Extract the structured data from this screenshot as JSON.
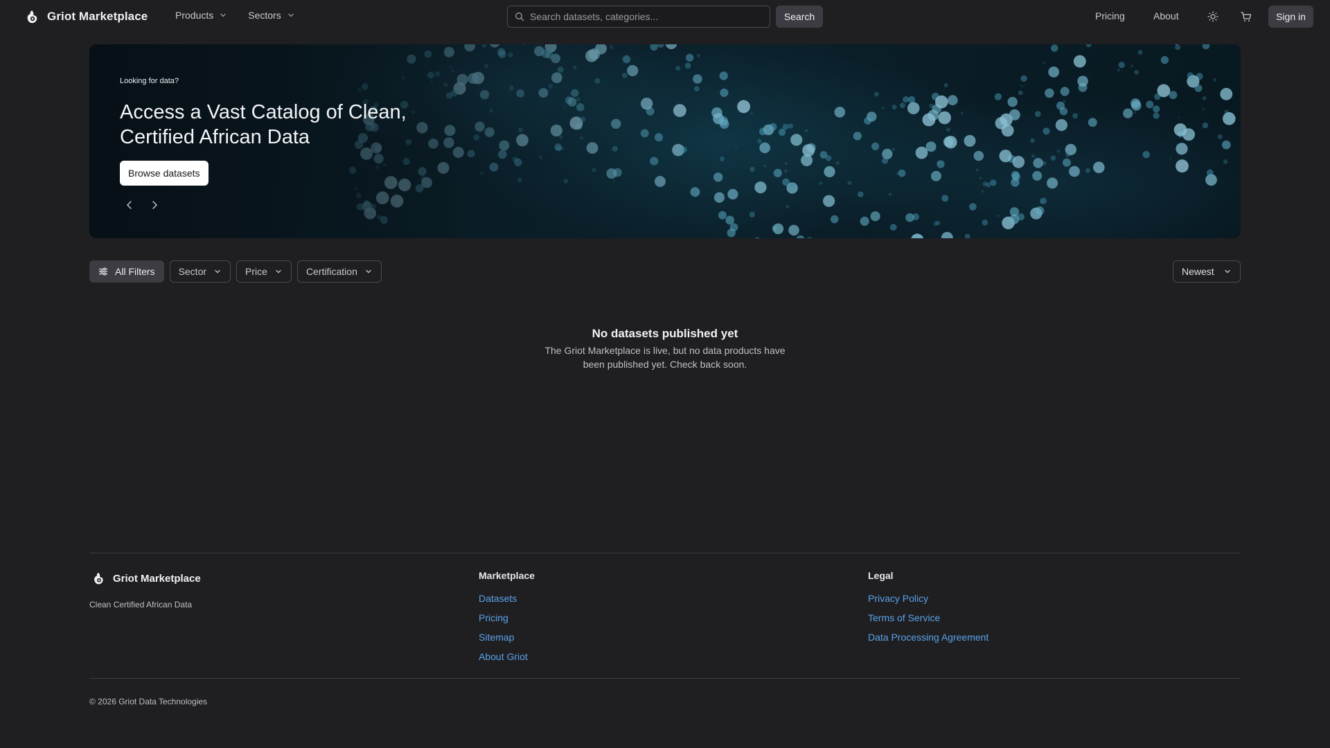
{
  "brand": {
    "name": "Griot Marketplace"
  },
  "nav": {
    "products_label": "Products",
    "sectors_label": "Sectors",
    "search_placeholder": "Search datasets, categories...",
    "search_label": "Search",
    "pricing_label": "Pricing",
    "about_label": "About",
    "theme_icon": "sun-icon",
    "cart_icon": "cart-icon",
    "signin_label": "Sign in"
  },
  "hero": {
    "eyebrow": "Looking for data?",
    "title": "Access a Vast Catalog of Clean, Certified African Data",
    "cta_label": "Browse datasets",
    "prev_icon": "chevron-left-icon",
    "next_icon": "chevron-right-icon"
  },
  "filters": {
    "all_filters_label": "All Filters",
    "sector_label": "Sector",
    "price_label": "Price",
    "certification_label": "Certification",
    "sort_label": "Newest"
  },
  "empty_state": {
    "title": "No datasets published yet",
    "description": "The Griot Marketplace is live, but no data products have been published yet. Check back soon."
  },
  "footer": {
    "brand_name": "Griot Marketplace",
    "tagline": "Clean Certified African Data",
    "marketplace": {
      "title": "Marketplace",
      "links": [
        "Datasets",
        "Pricing",
        "Sitemap",
        "About Griot"
      ]
    },
    "legal": {
      "title": "Legal",
      "links": [
        "Privacy Policy",
        "Terms of Service",
        "Data Processing Agreement"
      ]
    },
    "copyright": "© 2026 Griot Data Technologies"
  },
  "colors": {
    "background": "#1f1f22",
    "link": "#5aa2e8",
    "button": "#3c3c42"
  }
}
